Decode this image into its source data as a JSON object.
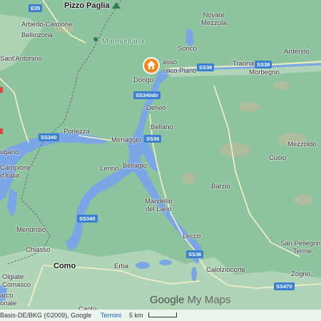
{
  "labels": {
    "pizzo_paglia": "Pizzo Paglia",
    "e35": "E35",
    "novate_mezzola": "Novate\nMezzola",
    "arbedo": "Arbedo-Castione",
    "bellinzona": "Bellinzona",
    "marmontana": "Marmontana",
    "sorico": "Sorico",
    "gravedona": "asso",
    "colico_piano": "olico Piano",
    "traona": "Traona",
    "ardenno": "Ardenno",
    "morbegno": "Morbegno",
    "sant_antonino": "Sant'Antonino",
    "dongo": "Dongo",
    "dervio": "Dervio",
    "porlezza": "Porlezza",
    "bellano": "Bellano",
    "menaggio": "Menaggio",
    "mezzoldo": "Mezzoldo",
    "lugano": "ugano",
    "cusio": "Cusio",
    "campione": "Campione\nd'Italia",
    "lenno": "Lenno",
    "bellagio": "Bellagio",
    "barzio": "Barzio",
    "mandello": "Mandello\ndel Lario",
    "mendrisio": "Mendrisio",
    "lecco": "Lecco",
    "chiasso": "Chiasso",
    "san_pellegrino": "San Pellegrino\nTerme",
    "como": "Como",
    "erba": "Erba",
    "calolziocorte": "Calolziocorte",
    "olgiate": "Olgiate\nComasco",
    "zogno": "Zogno",
    "arco": "arco\nonale",
    "cantu": "Cantù"
  },
  "roads": {
    "e35": "E35",
    "ss38a": "SS38",
    "ss38b": "SS38",
    "ss340dir": "SS340dir",
    "ss340a": "SS340",
    "ss36a": "SS36",
    "ss340b": "SS340",
    "ss36b": "SS36",
    "ss470": "SS470"
  },
  "footer": {
    "attribution": "Basis-DE/BKG (©2009), Google",
    "terms": "Termini",
    "scale": "5 km"
  },
  "logo": {
    "google": "Google",
    "mymaps": " My Maps"
  },
  "icons": {
    "pin": "home-marker-icon"
  },
  "colors": {
    "land": "#8ec3a0",
    "water": "#7aa6e6",
    "pin": "#f08a24"
  }
}
